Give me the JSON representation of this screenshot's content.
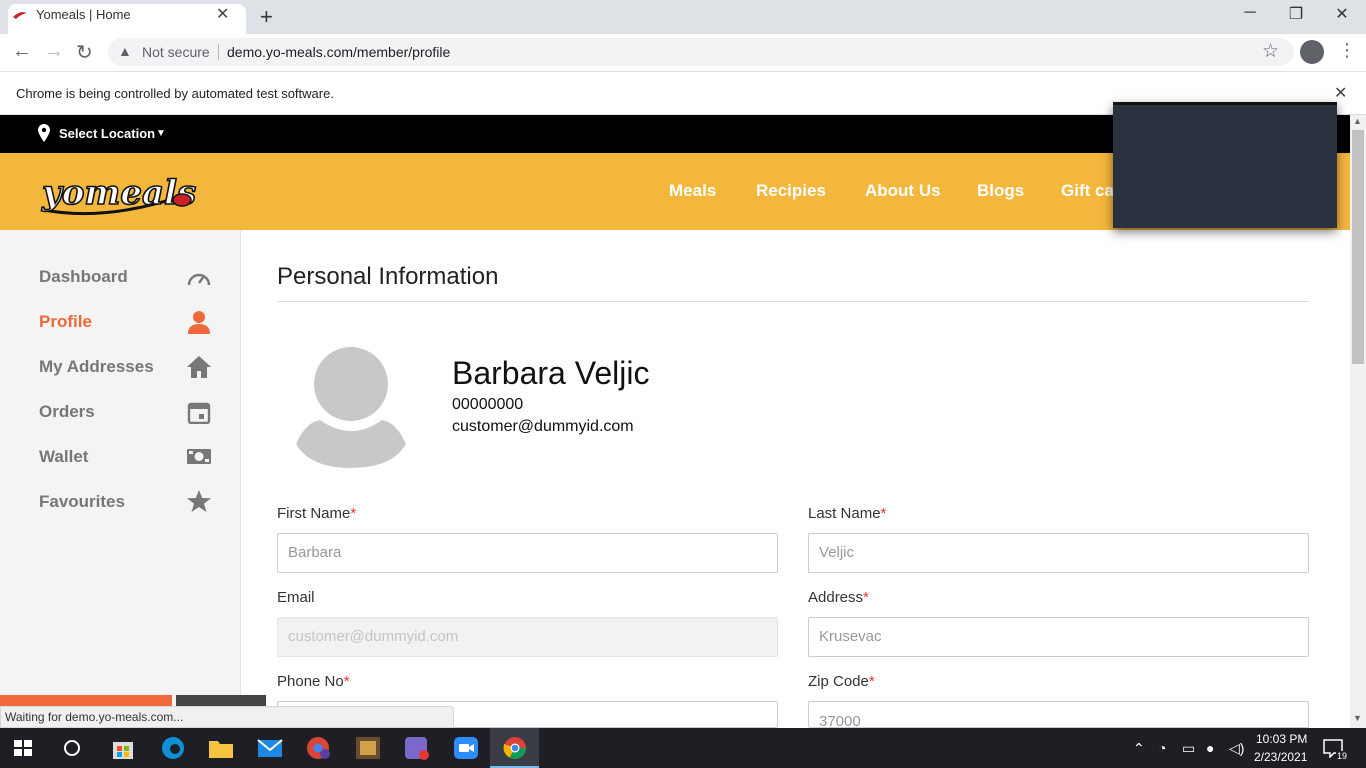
{
  "browser": {
    "tab_title": "Yomeals | Home",
    "tab_close": "✕",
    "new_tab": "+",
    "window_controls": [
      "─",
      "❐",
      "✕"
    ],
    "security_label": "Not secure",
    "url": "demo.yo-meals.com/member/profile",
    "infobar_text": "Chrome is being controlled by automated test software.",
    "infobar_close": "✕",
    "status_text": "Waiting for demo.yo-meals.com..."
  },
  "site": {
    "location_label": "Select Location",
    "nav": [
      "Meals",
      "Recipies",
      "About Us",
      "Blogs",
      "Gift ca"
    ],
    "brand_color": "#f3b73d",
    "accent_color": "#f0693a"
  },
  "sidebar": {
    "items": [
      {
        "label": "Dashboard",
        "icon": "speedometer-icon",
        "active": false
      },
      {
        "label": "Profile",
        "icon": "user-icon",
        "active": true
      },
      {
        "label": "My Addresses",
        "icon": "home-icon",
        "active": false
      },
      {
        "label": "Orders",
        "icon": "calendar-icon",
        "active": false
      },
      {
        "label": "Wallet",
        "icon": "money-icon",
        "active": false
      },
      {
        "label": "Favourites",
        "icon": "star-icon",
        "active": false
      }
    ]
  },
  "profile": {
    "title": "Personal Information",
    "name": "Barbara Veljic",
    "phone": "00000000",
    "email": "customer@dummyid.com",
    "required_mark": "*",
    "fields": {
      "first_name": {
        "label": "First Name",
        "value": "Barbara",
        "required": true
      },
      "last_name": {
        "label": "Last Name",
        "value": "Veljic",
        "required": true
      },
      "email": {
        "label": "Email",
        "value": "customer@dummyid.com",
        "required": false
      },
      "address": {
        "label": "Address",
        "value": "Krusevac",
        "required": true
      },
      "phone": {
        "label": "Phone No",
        "value": "",
        "required": true
      },
      "zip": {
        "label": "Zip Code",
        "value": "37000",
        "required": true
      }
    }
  },
  "taskbar": {
    "clock_time": "10:03 PM",
    "clock_date": "2/23/2021",
    "notifications": "19"
  }
}
